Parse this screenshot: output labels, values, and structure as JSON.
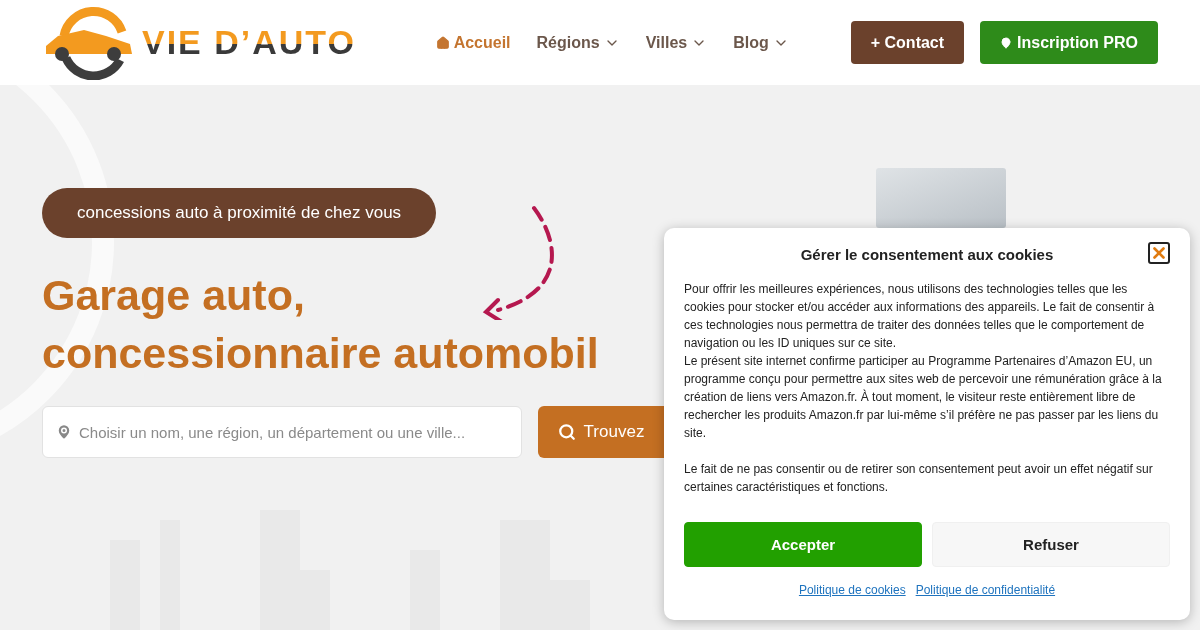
{
  "header": {
    "logo": "VIE D’AUTO",
    "nav": [
      {
        "label": "Accueil",
        "selected": true,
        "dropdown": false
      },
      {
        "label": "Régions",
        "selected": false,
        "dropdown": true
      },
      {
        "label": "Villes",
        "selected": false,
        "dropdown": true
      },
      {
        "label": "Blog",
        "selected": false,
        "dropdown": true
      }
    ],
    "contact_button": "+ Contact",
    "pro_button": "Inscription PRO"
  },
  "hero": {
    "tagline": "concessions auto à proximité de chez vous",
    "title_lines": [
      "Garage auto,",
      "concessionnaire automobil"
    ],
    "search": {
      "placeholder": "Choisir un nom, une région, un département ou une ville...",
      "button": "Trouvez"
    }
  },
  "cookie_dialog": {
    "title": "Gérer le consentement aux cookies",
    "paragraphs": [
      "Pour offrir les meilleures expériences, nous utilisons des technologies telles que les cookies pour stocker et/ou accéder aux informations des appareils. Le fait de consentir à ces technologies nous permettra de traiter des données telles que le comportement de navigation ou les ID uniques sur ce site.",
      "Le présent site internet confirme participer au Programme Partenaires d’Amazon EU, un programme conçu pour permettre aux sites web de percevoir une rémunération grâce à la création de liens vers Amazon.fr. À tout moment, le visiteur reste entièrement libre de rechercher les produits Amazon.fr par lui-même s’il préfère ne pas passer par les liens du site.",
      "Le fait de ne pas consentir ou de retirer son consentement peut avoir un effet négatif sur certaines caractéristiques et fonctions."
    ],
    "accept": "Accepter",
    "refuse": "Refuser",
    "links": [
      "Politique de cookies",
      "Politique de confidentialité"
    ]
  }
}
